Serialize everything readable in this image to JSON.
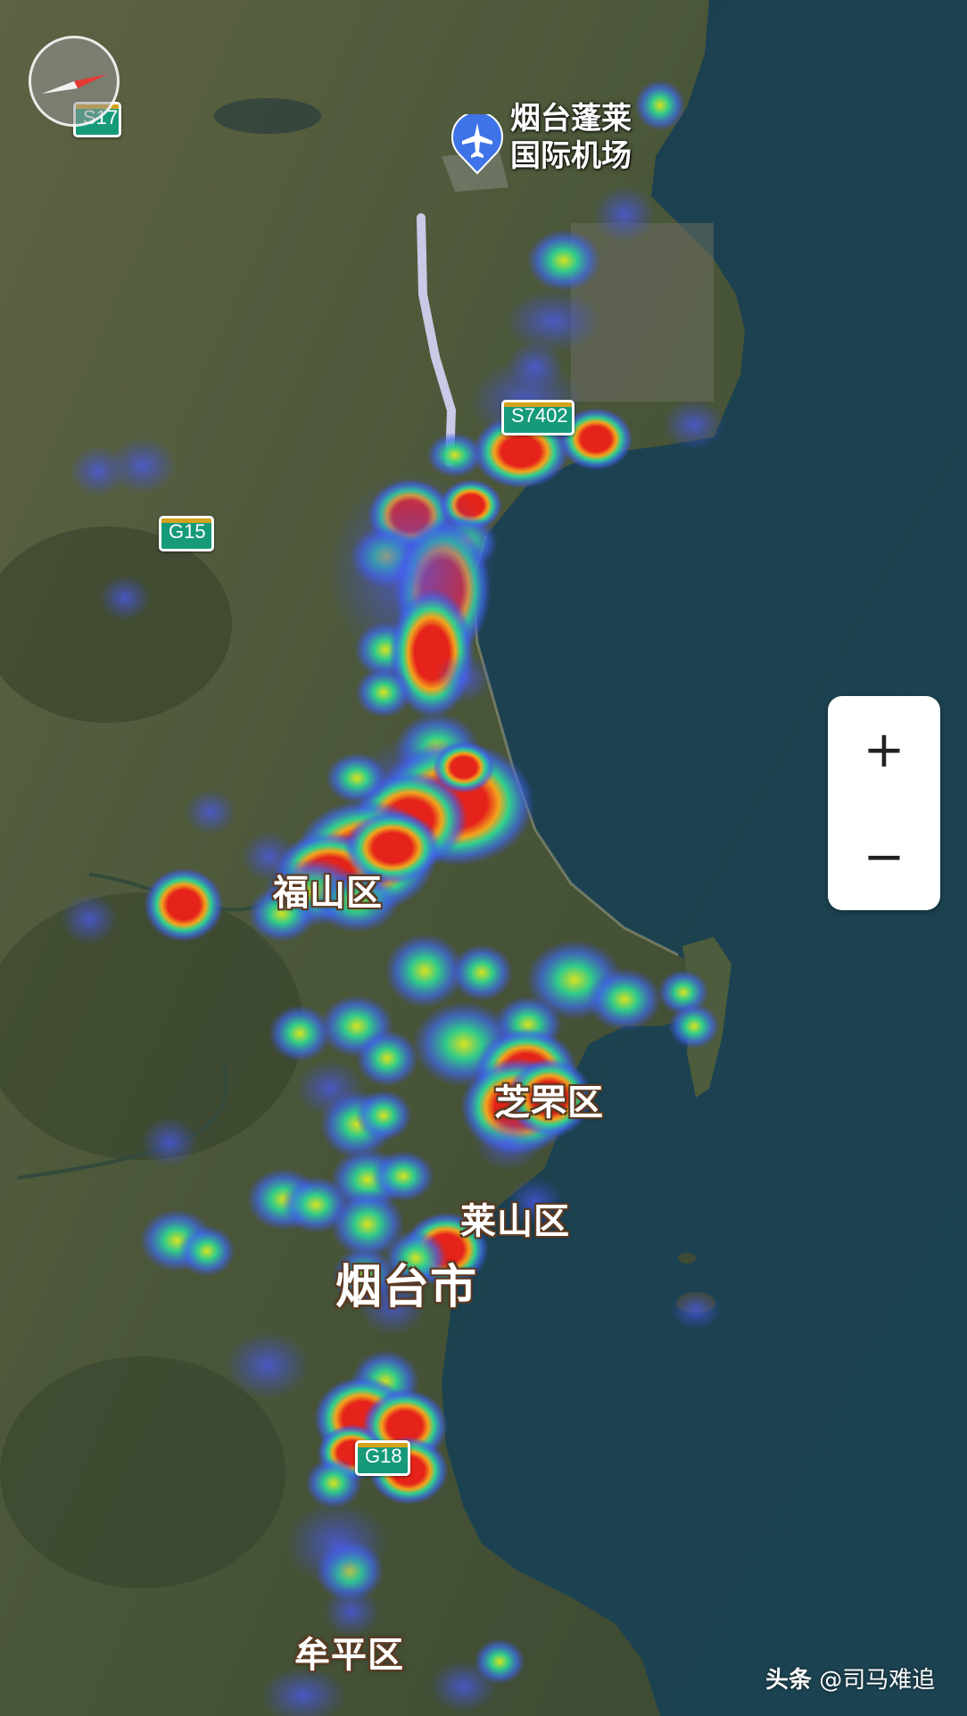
{
  "map": {
    "city_label": "烟台市",
    "districts": {
      "fushan": "福山区",
      "zhifu": "芝罘区",
      "laishan": "莱山区",
      "muping": "牟平区"
    },
    "airport": {
      "name_line1": "烟台蓬莱",
      "name_line2": "国际机场",
      "icon": "airplane-icon"
    },
    "road_shields": {
      "s17": "S17",
      "g15": "G15",
      "s7402": "S7402",
      "g18": "G18"
    },
    "overlay": "heatmap",
    "colors": {
      "sea": "#1f4656",
      "land": "#4a5638",
      "shield": "#169a7a",
      "heat_low": "#3f4fd8",
      "heat_mid": "#23c7b0",
      "heat_high": "#e5231a"
    }
  },
  "controls": {
    "zoom_in_label": "+",
    "zoom_out_label": "−",
    "compass_icon": "compass-icon"
  },
  "watermark": {
    "prefix": "头条",
    "handle": "@司马难追"
  }
}
